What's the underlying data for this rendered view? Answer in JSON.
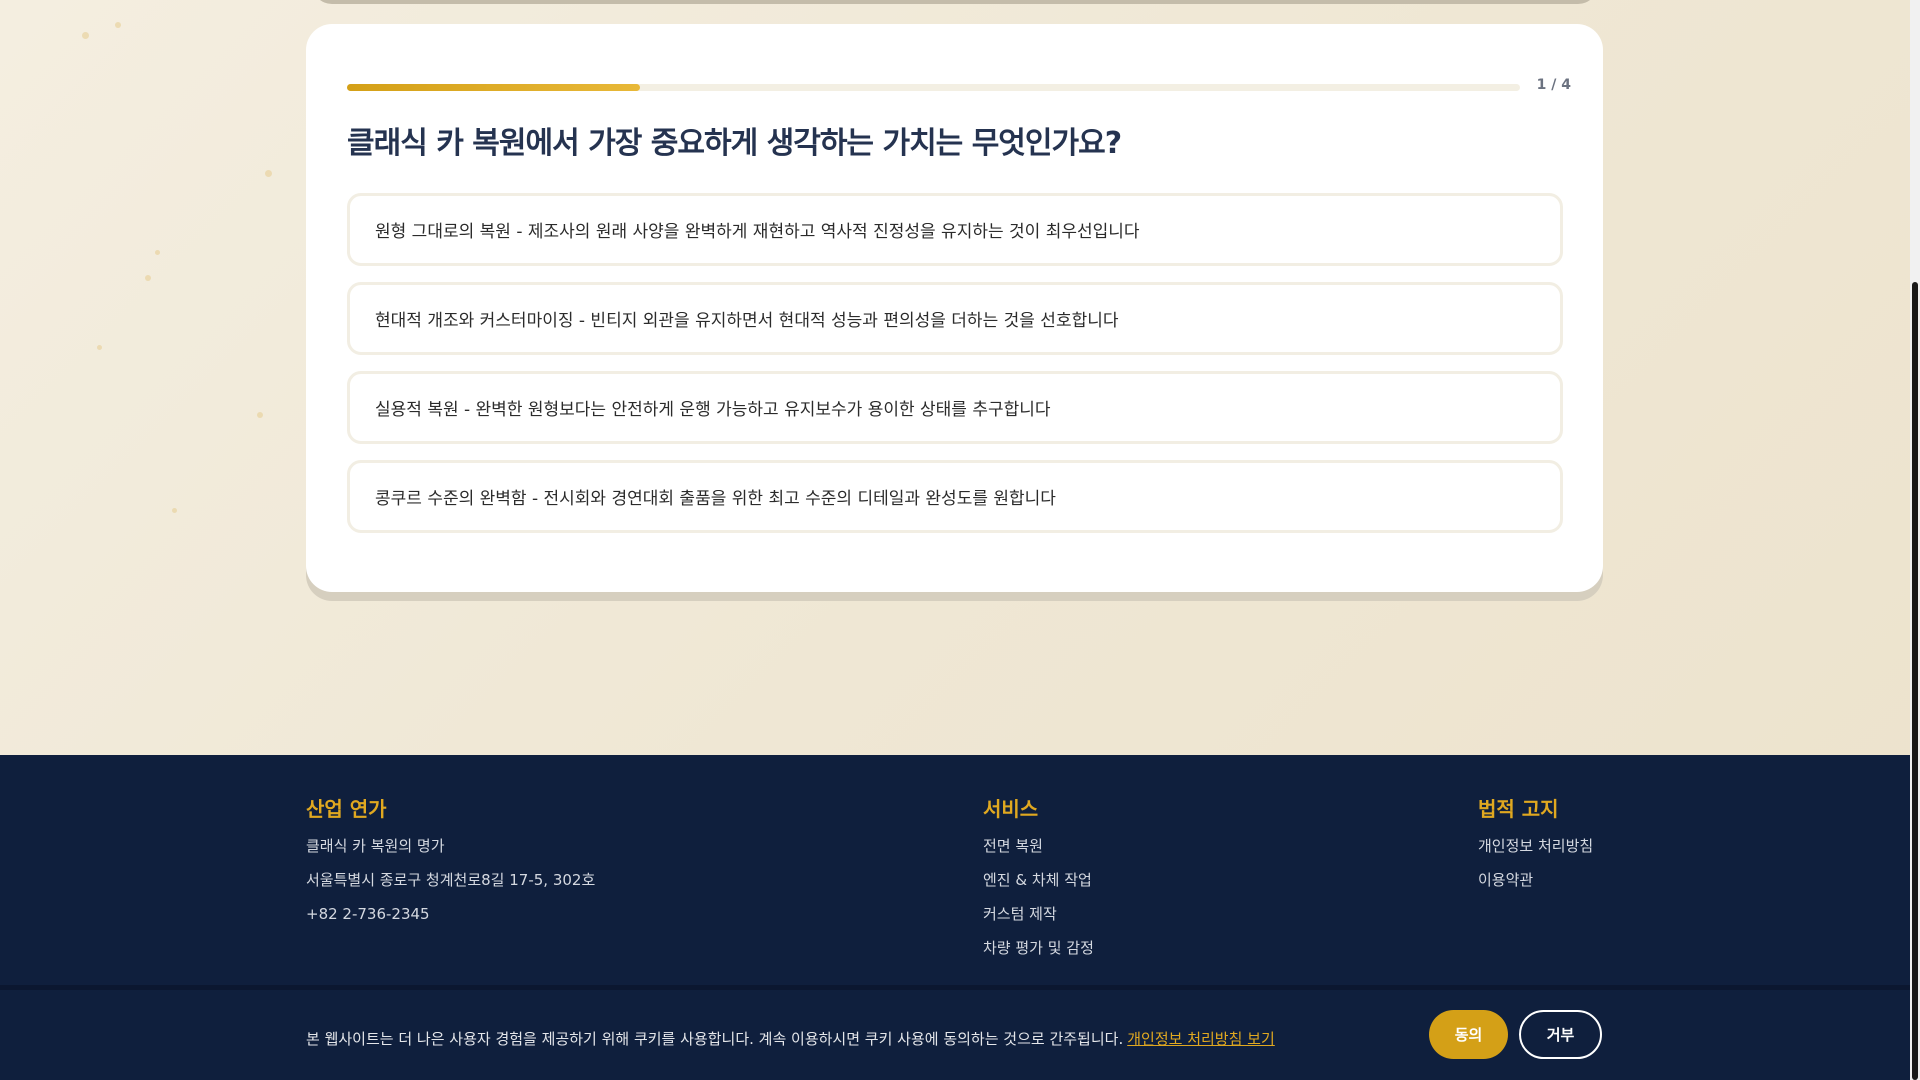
{
  "quiz": {
    "progress_percent": 25,
    "counter": "1 / 4",
    "question": "클래식 카 복원에서 가장 중요하게 생각하는 가치는 무엇인가요?",
    "options": [
      "원형 그대로의 복원 - 제조사의 원래 사양을 완벽하게 재현하고 역사적 진정성을 유지하는 것이 최우선입니다",
      "현대적 개조와 커스터마이징 - 빈티지 외관을 유지하면서 현대적 성능과 편의성을 더하는 것을 선호합니다",
      "실용적 복원 - 완벽한 원형보다는 안전하게 운행 가능하고 유지보수가 용이한 상태를 추구합니다",
      "콩쿠르 수준의 완벽함 - 전시회와 경연대회 출품을 위한 최고 수준의 디테일과 완성도를 원합니다"
    ]
  },
  "footer": {
    "company": {
      "title": "산업 연가",
      "items": [
        "클래식 카 복원의 명가",
        "서울특별시 종로구 청계천로8길 17-5, 302호",
        "+82 2-736-2345"
      ]
    },
    "services": {
      "title": "서비스",
      "items": [
        "전면 복원",
        "엔진 & 차체 작업",
        "커스텀 제작",
        "차량 평가 및 감정"
      ]
    },
    "legal": {
      "title": "법적 고지",
      "items": [
        "개인정보 처리방침",
        "이용약관"
      ]
    }
  },
  "cookie": {
    "text": "본 웹사이트는 더 나은 사용자 경험을 제공하기 위해 쿠키를 사용합니다. 계속 이용하시면 쿠키 사용에 동의하는 것으로 간주됩니다.",
    "link": "개인정보 처리방침 보기",
    "agree": "동의",
    "reject": "거부"
  },
  "colors": {
    "accent": "#d4a017",
    "navy": "#0f1f3d",
    "heading": "#253350"
  }
}
